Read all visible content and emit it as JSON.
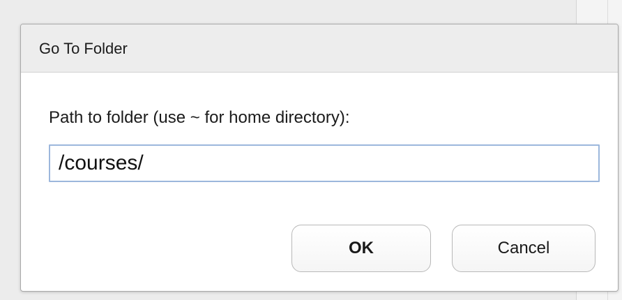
{
  "dialog": {
    "title": "Go To Folder",
    "label": "Path to folder (use ~ for home directory):",
    "path_value": "/courses/"
  },
  "buttons": {
    "ok_label": "OK",
    "cancel_label": "Cancel"
  },
  "colors": {
    "titlebar": "#ededed",
    "input_focus_border": "#9cb7dc",
    "dialog_background": "#ffffff"
  }
}
